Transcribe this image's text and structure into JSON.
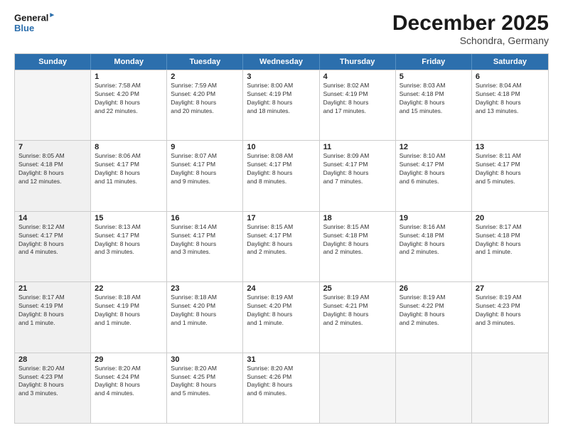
{
  "header": {
    "logo_line1": "General",
    "logo_line2": "Blue",
    "month": "December 2025",
    "location": "Schondra, Germany"
  },
  "weekdays": [
    "Sunday",
    "Monday",
    "Tuesday",
    "Wednesday",
    "Thursday",
    "Friday",
    "Saturday"
  ],
  "rows": [
    [
      {
        "day": "",
        "info": "",
        "empty": true
      },
      {
        "day": "1",
        "info": "Sunrise: 7:58 AM\nSunset: 4:20 PM\nDaylight: 8 hours\nand 22 minutes."
      },
      {
        "day": "2",
        "info": "Sunrise: 7:59 AM\nSunset: 4:20 PM\nDaylight: 8 hours\nand 20 minutes."
      },
      {
        "day": "3",
        "info": "Sunrise: 8:00 AM\nSunset: 4:19 PM\nDaylight: 8 hours\nand 18 minutes."
      },
      {
        "day": "4",
        "info": "Sunrise: 8:02 AM\nSunset: 4:19 PM\nDaylight: 8 hours\nand 17 minutes."
      },
      {
        "day": "5",
        "info": "Sunrise: 8:03 AM\nSunset: 4:18 PM\nDaylight: 8 hours\nand 15 minutes."
      },
      {
        "day": "6",
        "info": "Sunrise: 8:04 AM\nSunset: 4:18 PM\nDaylight: 8 hours\nand 13 minutes."
      }
    ],
    [
      {
        "day": "7",
        "info": "Sunrise: 8:05 AM\nSunset: 4:18 PM\nDaylight: 8 hours\nand 12 minutes.",
        "shaded": true
      },
      {
        "day": "8",
        "info": "Sunrise: 8:06 AM\nSunset: 4:17 PM\nDaylight: 8 hours\nand 11 minutes."
      },
      {
        "day": "9",
        "info": "Sunrise: 8:07 AM\nSunset: 4:17 PM\nDaylight: 8 hours\nand 9 minutes."
      },
      {
        "day": "10",
        "info": "Sunrise: 8:08 AM\nSunset: 4:17 PM\nDaylight: 8 hours\nand 8 minutes."
      },
      {
        "day": "11",
        "info": "Sunrise: 8:09 AM\nSunset: 4:17 PM\nDaylight: 8 hours\nand 7 minutes."
      },
      {
        "day": "12",
        "info": "Sunrise: 8:10 AM\nSunset: 4:17 PM\nDaylight: 8 hours\nand 6 minutes."
      },
      {
        "day": "13",
        "info": "Sunrise: 8:11 AM\nSunset: 4:17 PM\nDaylight: 8 hours\nand 5 minutes."
      }
    ],
    [
      {
        "day": "14",
        "info": "Sunrise: 8:12 AM\nSunset: 4:17 PM\nDaylight: 8 hours\nand 4 minutes.",
        "shaded": true
      },
      {
        "day": "15",
        "info": "Sunrise: 8:13 AM\nSunset: 4:17 PM\nDaylight: 8 hours\nand 3 minutes."
      },
      {
        "day": "16",
        "info": "Sunrise: 8:14 AM\nSunset: 4:17 PM\nDaylight: 8 hours\nand 3 minutes."
      },
      {
        "day": "17",
        "info": "Sunrise: 8:15 AM\nSunset: 4:17 PM\nDaylight: 8 hours\nand 2 minutes."
      },
      {
        "day": "18",
        "info": "Sunrise: 8:15 AM\nSunset: 4:18 PM\nDaylight: 8 hours\nand 2 minutes."
      },
      {
        "day": "19",
        "info": "Sunrise: 8:16 AM\nSunset: 4:18 PM\nDaylight: 8 hours\nand 2 minutes."
      },
      {
        "day": "20",
        "info": "Sunrise: 8:17 AM\nSunset: 4:18 PM\nDaylight: 8 hours\nand 1 minute."
      }
    ],
    [
      {
        "day": "21",
        "info": "Sunrise: 8:17 AM\nSunset: 4:19 PM\nDaylight: 8 hours\nand 1 minute.",
        "shaded": true
      },
      {
        "day": "22",
        "info": "Sunrise: 8:18 AM\nSunset: 4:19 PM\nDaylight: 8 hours\nand 1 minute."
      },
      {
        "day": "23",
        "info": "Sunrise: 8:18 AM\nSunset: 4:20 PM\nDaylight: 8 hours\nand 1 minute."
      },
      {
        "day": "24",
        "info": "Sunrise: 8:19 AM\nSunset: 4:20 PM\nDaylight: 8 hours\nand 1 minute."
      },
      {
        "day": "25",
        "info": "Sunrise: 8:19 AM\nSunset: 4:21 PM\nDaylight: 8 hours\nand 2 minutes."
      },
      {
        "day": "26",
        "info": "Sunrise: 8:19 AM\nSunset: 4:22 PM\nDaylight: 8 hours\nand 2 minutes."
      },
      {
        "day": "27",
        "info": "Sunrise: 8:19 AM\nSunset: 4:23 PM\nDaylight: 8 hours\nand 3 minutes."
      }
    ],
    [
      {
        "day": "28",
        "info": "Sunrise: 8:20 AM\nSunset: 4:23 PM\nDaylight: 8 hours\nand 3 minutes.",
        "shaded": true
      },
      {
        "day": "29",
        "info": "Sunrise: 8:20 AM\nSunset: 4:24 PM\nDaylight: 8 hours\nand 4 minutes."
      },
      {
        "day": "30",
        "info": "Sunrise: 8:20 AM\nSunset: 4:25 PM\nDaylight: 8 hours\nand 5 minutes."
      },
      {
        "day": "31",
        "info": "Sunrise: 8:20 AM\nSunset: 4:26 PM\nDaylight: 8 hours\nand 6 minutes."
      },
      {
        "day": "",
        "info": "",
        "empty": true
      },
      {
        "day": "",
        "info": "",
        "empty": true
      },
      {
        "day": "",
        "info": "",
        "empty": true
      }
    ]
  ]
}
